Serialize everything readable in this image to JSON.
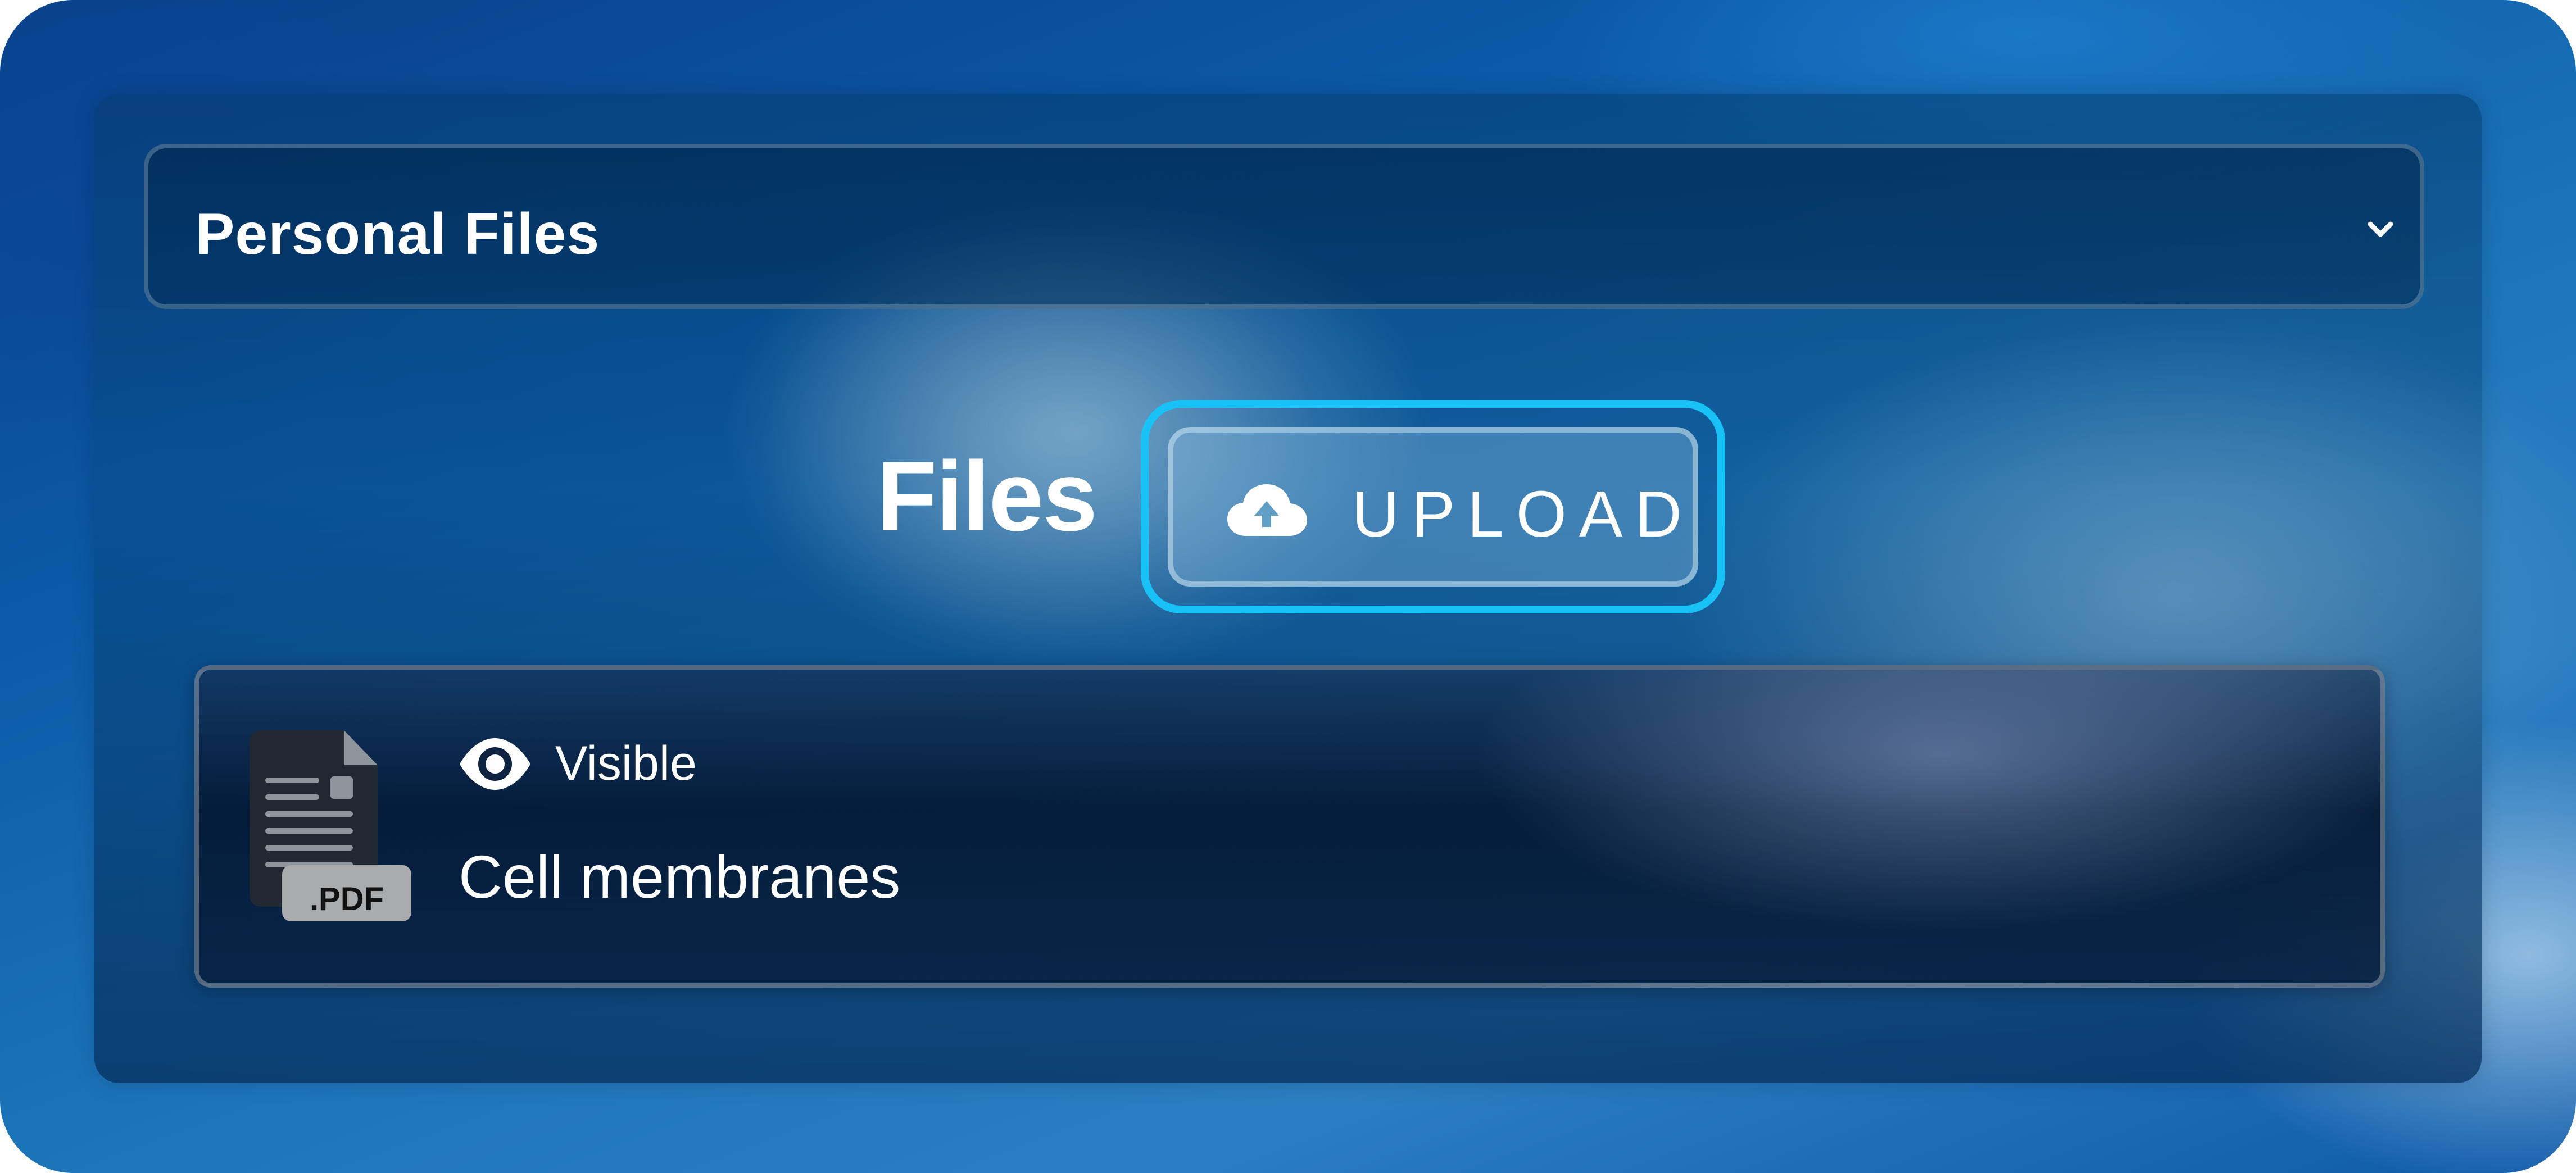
{
  "folder_select": {
    "selected": "Personal Files",
    "icon": "chevron-down-icon"
  },
  "files_section": {
    "title": "Files",
    "upload_button": {
      "label": "UPLOAD",
      "icon": "cloud-upload-icon",
      "focus_ring_color": "#18c2f7"
    }
  },
  "files": [
    {
      "name": "Cell membranes",
      "visibility": "Visible",
      "visibility_icon": "eye-icon",
      "file_type_label": ".PDF",
      "file_icon": "pdf-file-icon"
    }
  ]
}
